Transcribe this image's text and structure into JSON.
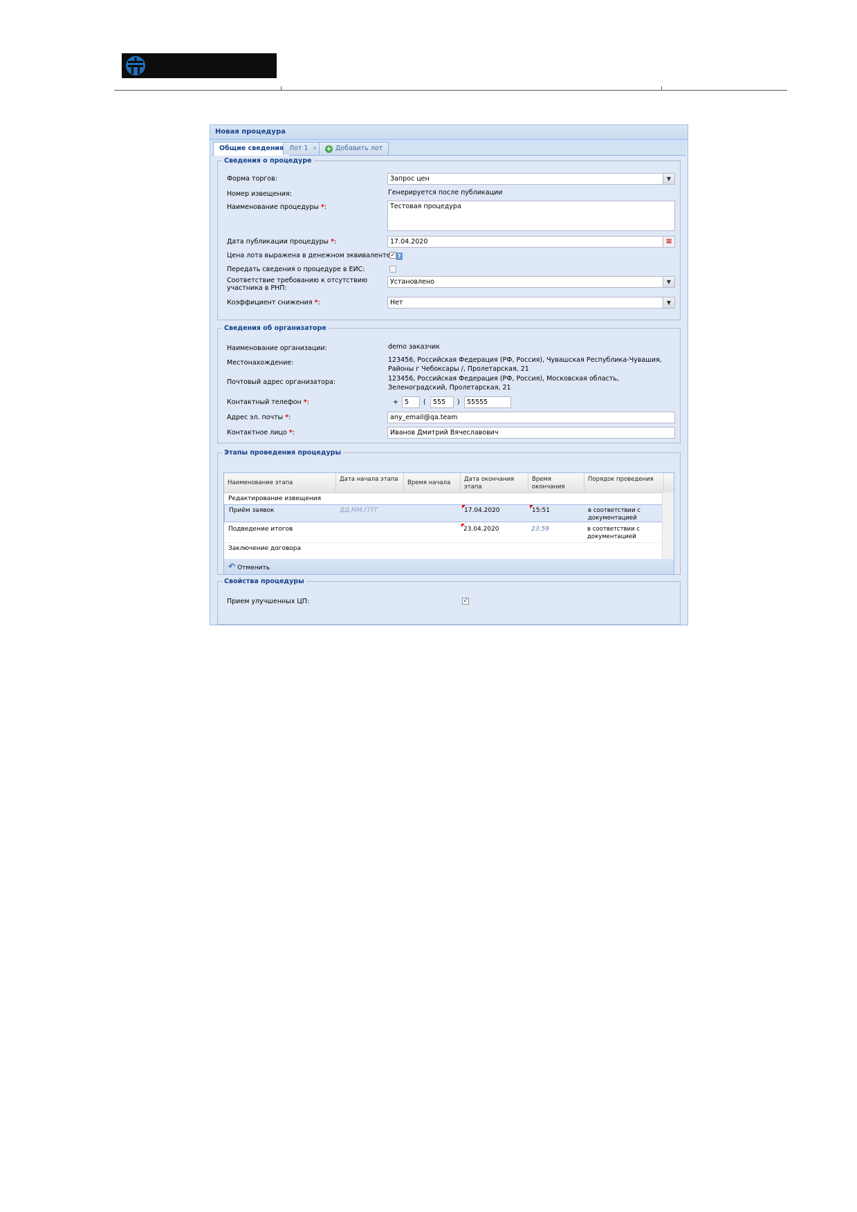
{
  "window": {
    "title": "Новая процедура",
    "tabs": [
      {
        "label": "Общие сведения",
        "active": true
      },
      {
        "label": "Лот 1",
        "closable": true
      },
      {
        "label": "Добавить лот",
        "icon": "add-icon"
      }
    ]
  },
  "procedure_info": {
    "legend": "Сведения о процедуре",
    "trade_form_label": "Форма торгов:",
    "trade_form_value": "Запрос цен",
    "notice_number_label": "Номер извещения:",
    "notice_number_value": "Генерируется после публикации",
    "name_label": "Наименование процедуры",
    "name_value": "Тестовая процедура",
    "pub_date_label": "Дата публикации процедуры",
    "pub_date_value": "17.04.2020",
    "price_money_label": "Цена лота выражена в денежном эквиваленте:",
    "price_money_help": "?",
    "eis_label": "Передать сведения о процедуре в ЕИС:",
    "rnp_label": "Соответствие требованию к отсутствию участника в РНП:",
    "rnp_value": "Установлено",
    "coef_label": "Коэффициент снижения",
    "coef_value": "Нет",
    "required_mark": "*",
    "colon": ":"
  },
  "organizer_info": {
    "legend": "Сведения об организаторе",
    "org_name_label": "Наименование организации:",
    "org_name_value": "demo заказчик",
    "location_label": "Местонахождение:",
    "location_line1": "123456, Российская Федерация (РФ, Россия), Чувашская Республика-Чувашия,",
    "location_line2": "Районы г Чебоксары /, Пролетарская, 21",
    "postal_label": "Почтовый адрес организатора:",
    "postal_line1": "123456, Российская Федерация (РФ, Россия), Московская область,",
    "postal_line2": "Зеленоградский, Пролетарская, 21",
    "phone_label": "Контактный телефон",
    "phone_plus": "+",
    "phone_country": "5",
    "phone_open": "(",
    "phone_code": "555",
    "phone_close": ")",
    "phone_number": "55555",
    "email_label": "Адрес эл. почты",
    "email_value": "any_email@qa.team",
    "contact_label": "Контактное лицо",
    "contact_value": "Иванов Дмитрий Вячеславович"
  },
  "stages": {
    "legend": "Этапы проведения процедуры",
    "headers": [
      "Наименование этапа",
      "Дата начала этапа",
      "Время начала",
      "Дата окончания этапа",
      "Время окончания",
      "Порядок проведения"
    ],
    "rows": [
      {
        "name": "Редактирование извещения",
        "start_date": "",
        "start_time": "",
        "end_date": "",
        "end_time": "",
        "order": ""
      },
      {
        "name": "Приём заявок",
        "start_date": "ДД.ММ.ГГГГ",
        "start_time": "",
        "end_date": "17.04.2020",
        "end_time": "15:51",
        "order": "в соответствии с документацией"
      },
      {
        "name": "Подведение итогов",
        "start_date": "",
        "start_time": "",
        "end_date": "23.04.2020",
        "end_time": "23:59",
        "order": "в соответствии с документацией"
      },
      {
        "name": "Заключение договора",
        "start_date": "",
        "start_time": "",
        "end_date": "",
        "end_time": "",
        "order": ""
      }
    ],
    "undo_label": "Отменить"
  },
  "properties": {
    "legend": "Свойства процедуры",
    "enhanced_sig_label": "Прием улучшенных ЦП:"
  }
}
